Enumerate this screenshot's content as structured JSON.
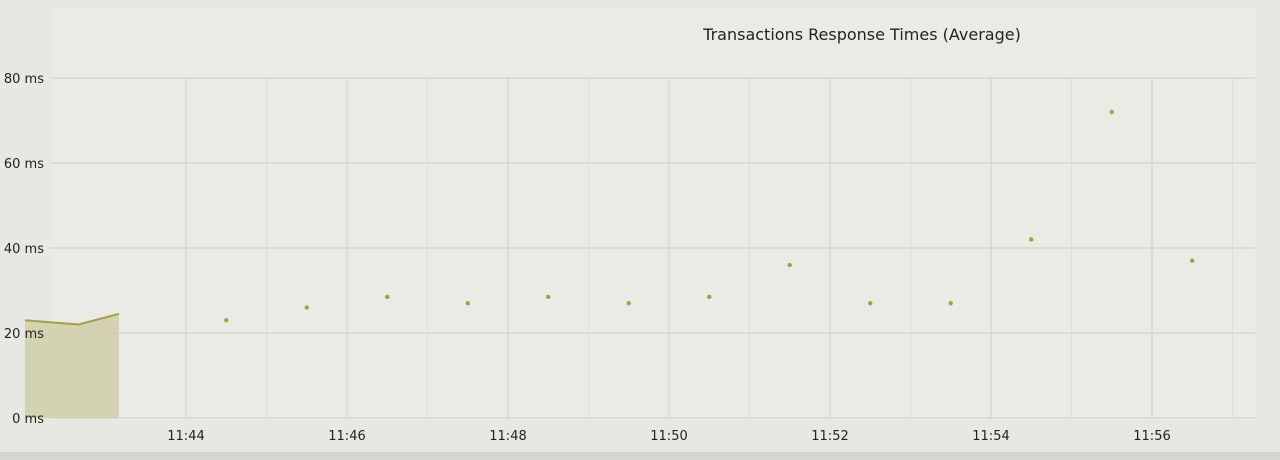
{
  "colors": {
    "background": "#e8e8e3",
    "plot_background": "#ececE7",
    "grid": "#d2d2cc",
    "series": "#a3a33a",
    "area_fill": "#cfcfa8",
    "text": "#222222"
  },
  "chart_data": {
    "type": "line",
    "title": "Transactions Response Times (Average)",
    "xlabel": "",
    "ylabel": "",
    "x_ticks": [
      "11:44",
      "11:46",
      "11:48",
      "11:50",
      "11:52",
      "11:54",
      "11:56"
    ],
    "y_ticks": [
      "0 ms",
      "20 ms",
      "40 ms",
      "60 ms",
      "80 ms"
    ],
    "ylim": [
      0,
      80
    ],
    "grid": true,
    "legend": "none",
    "series": [
      {
        "x": [
          "11:42:00",
          "11:42:40",
          "11:43:10",
          "11:44:30",
          "11:45:30",
          "11:46:30",
          "11:47:30",
          "11:48:30",
          "11:49:30",
          "11:50:30",
          "11:51:30",
          "11:52:30",
          "11:53:30",
          "11:54:30",
          "11:55:30",
          "11:56:30"
        ],
        "values": [
          23,
          22,
          24.5,
          23,
          26,
          28.5,
          27,
          28.5,
          27,
          28.5,
          36,
          27,
          27,
          42,
          72,
          37
        ],
        "area_segment_end": 2
      }
    ]
  }
}
